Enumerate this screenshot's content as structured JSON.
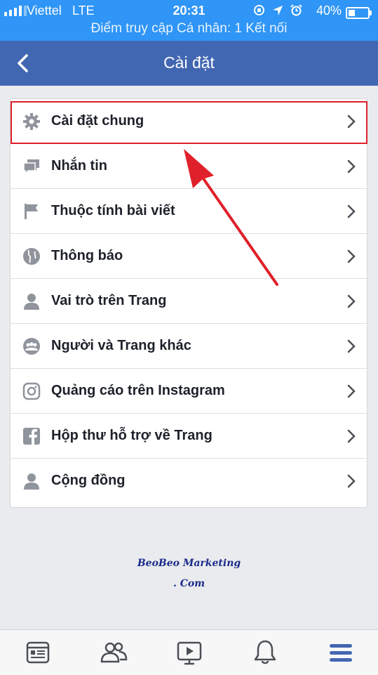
{
  "status_bar": {
    "carrier": "Viettel",
    "network": "LTE",
    "time": "20:31",
    "battery_percent": "40%",
    "battery_level": 0.4,
    "hotspot_text": "Điểm truy cập Cá nhân: 1 Kết nối"
  },
  "navbar": {
    "title": "Cài đặt"
  },
  "settings": {
    "items": [
      {
        "label": "Cài đặt chung",
        "icon": "gear-icon"
      },
      {
        "label": "Nhắn tin",
        "icon": "chat-icon"
      },
      {
        "label": "Thuộc tính bài viết",
        "icon": "flag-icon"
      },
      {
        "label": "Thông báo",
        "icon": "globe-icon"
      },
      {
        "label": "Vai trò trên Trang",
        "icon": "person-icon"
      },
      {
        "label": "Người và Trang khác",
        "icon": "people-icon"
      },
      {
        "label": "Quảng cáo trên Instagram",
        "icon": "instagram-icon"
      },
      {
        "label": "Hộp thư hỗ trợ về Trang",
        "icon": "facebook-icon"
      },
      {
        "label": "Cộng đồng",
        "icon": "person-icon"
      }
    ]
  },
  "watermark": {
    "line1": "BeoBeo Marketing",
    "line2": ". Com"
  },
  "tab_bar": {
    "tabs": [
      {
        "icon": "news-feed-icon"
      },
      {
        "icon": "friends-icon"
      },
      {
        "icon": "video-icon"
      },
      {
        "icon": "notifications-bell-icon"
      },
      {
        "icon": "menu-icon",
        "active": true
      }
    ]
  },
  "colors": {
    "status_bar": "#2f95f6",
    "navbar": "#4267b2",
    "highlight": "#e0202a",
    "active_tab": "#4267b2"
  }
}
